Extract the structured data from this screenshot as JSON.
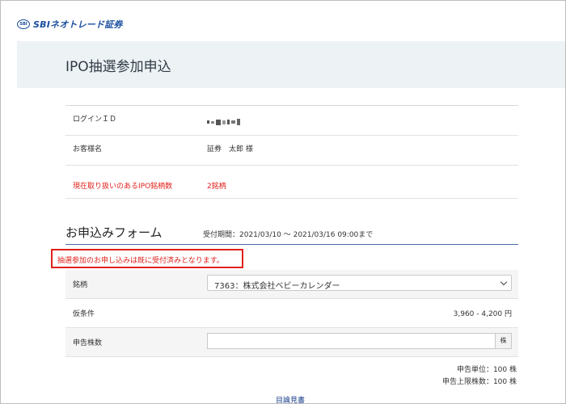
{
  "logo": {
    "mark": "SBI",
    "text": "SBIネオトレード証券"
  },
  "page_title": "IPO抽選参加申込",
  "info": {
    "login_label": "ログインＩＤ",
    "name_label": "お客様名",
    "name_value": "証券　太郎 様",
    "ipo_label": "現在取り扱いのあるIPO銘柄数",
    "ipo_value": "2銘柄"
  },
  "form": {
    "heading": "お申込みフォーム",
    "period": "受付期間：2021/03/10 ～ 2021/03/16 09:00まで",
    "alert": "抽選参加のお申し込みは既に受付済みとなります。",
    "stock_label": "銘柄",
    "stock_selected": "7363：株式会社ベビーカレンダー",
    "condition_label": "仮条件",
    "condition_value": "3,960 - 4,200 円",
    "qty_label": "申告株数",
    "qty_value": "",
    "qty_unit": "株",
    "unit_note": "申告単位：100 株",
    "limit_note": "申告上限株数：100 株"
  },
  "prospectus_link": "目論見書",
  "colors": {
    "accent_red": "#e0201a",
    "brand_blue": "#1a4fa0"
  }
}
